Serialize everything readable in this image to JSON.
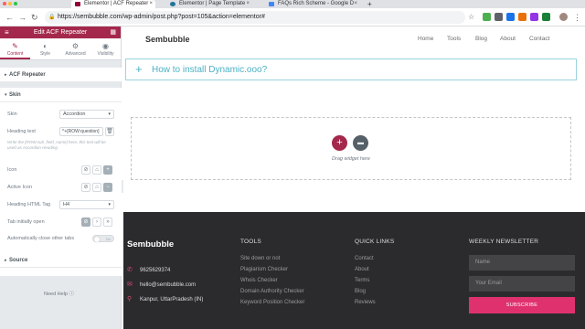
{
  "browser": {
    "tabs": [
      {
        "title": "Elementor | ACF Repeater",
        "color": "#92003b"
      },
      {
        "title": "Elementor | Page Template",
        "color": "#21759b"
      },
      {
        "title": "FAQs Rich Scheme - Google D",
        "color": "#4285f4"
      }
    ],
    "new_tab": "+",
    "url": "https://sembubble.com/wp-admin/post.php?post=105&action=elementor#",
    "url_host": "sembubble.com"
  },
  "editor": {
    "title": "Edit ACF Repeater",
    "tabs": [
      "Content",
      "Style",
      "Advanced",
      "Visibility"
    ],
    "sections": {
      "acf_repeater": "ACF Repeater",
      "skin": "Skin",
      "source": "Source"
    },
    "controls": {
      "skin_label": "Skin",
      "skin_value": "Accordion",
      "heading_text_label": "Heading text",
      "heading_text_value": "^+[ROW:question]",
      "heading_hint": "Write the [ROW:sub_field_name] here, this text will be used as Accordion Heading",
      "icon_label": "Icon",
      "active_icon_label": "Active Icon",
      "heading_tag_label": "Heading HTML Tag",
      "heading_tag_value": "H4",
      "tab_open_label": "Tab initially open",
      "auto_close_label": "Automatically close other tabs",
      "toggle_value": "No"
    },
    "need_help": "Need Help"
  },
  "site": {
    "logo": "Sembubble",
    "nav": [
      "Home",
      "Tools",
      "Blog",
      "About",
      "Contact"
    ],
    "faq_title": "How to install Dynamic.ooo?",
    "drag_text": "Drag widget here",
    "footer": {
      "logo": "Sembubble",
      "phone": "9625629374",
      "email": "hello@sembubble.com",
      "address": "Kanpur, UttarPradesh (IN)",
      "tools_heading": "TOOLS",
      "tools": [
        "Site down or not",
        "Plagiarism Checker",
        "Whois Checker",
        "Domain Authority Checker",
        "Keyword Position Checker"
      ],
      "quick_heading": "QUICK LINKS",
      "quick": [
        "Contact",
        "About",
        "Terms",
        "Blog",
        "Reviews"
      ],
      "newsletter_heading": "WEEKLY NEWSLETTER",
      "name_placeholder": "Name",
      "email_placeholder": "Your Email",
      "subscribe": "SUBSCRIBE"
    }
  },
  "colors": {
    "elementor_accent": "#a4284c",
    "faq_accent": "#4bb1c3",
    "footer_bg": "#2b2b2e",
    "subscribe_bg": "#e0316f"
  }
}
